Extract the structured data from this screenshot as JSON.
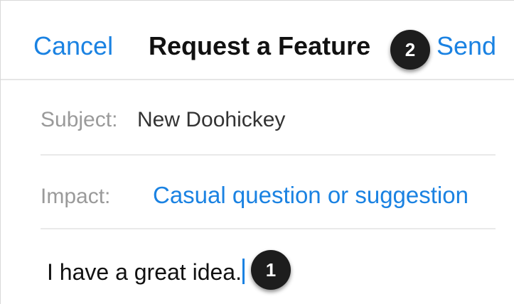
{
  "nav": {
    "cancel_label": "Cancel",
    "title": "Request a Feature",
    "send_label": "Send"
  },
  "form": {
    "subject_label": "Subject:",
    "subject_value": "New Doohickey",
    "impact_label": "Impact:",
    "impact_value": "Casual question or suggestion",
    "body_value": "I have a great idea."
  },
  "callouts": {
    "badge_1": "1",
    "badge_2": "2"
  },
  "colors": {
    "accent": "#1a82e2",
    "badge_bg": "#1d1d1d",
    "label_gray": "#9a9a9a"
  }
}
